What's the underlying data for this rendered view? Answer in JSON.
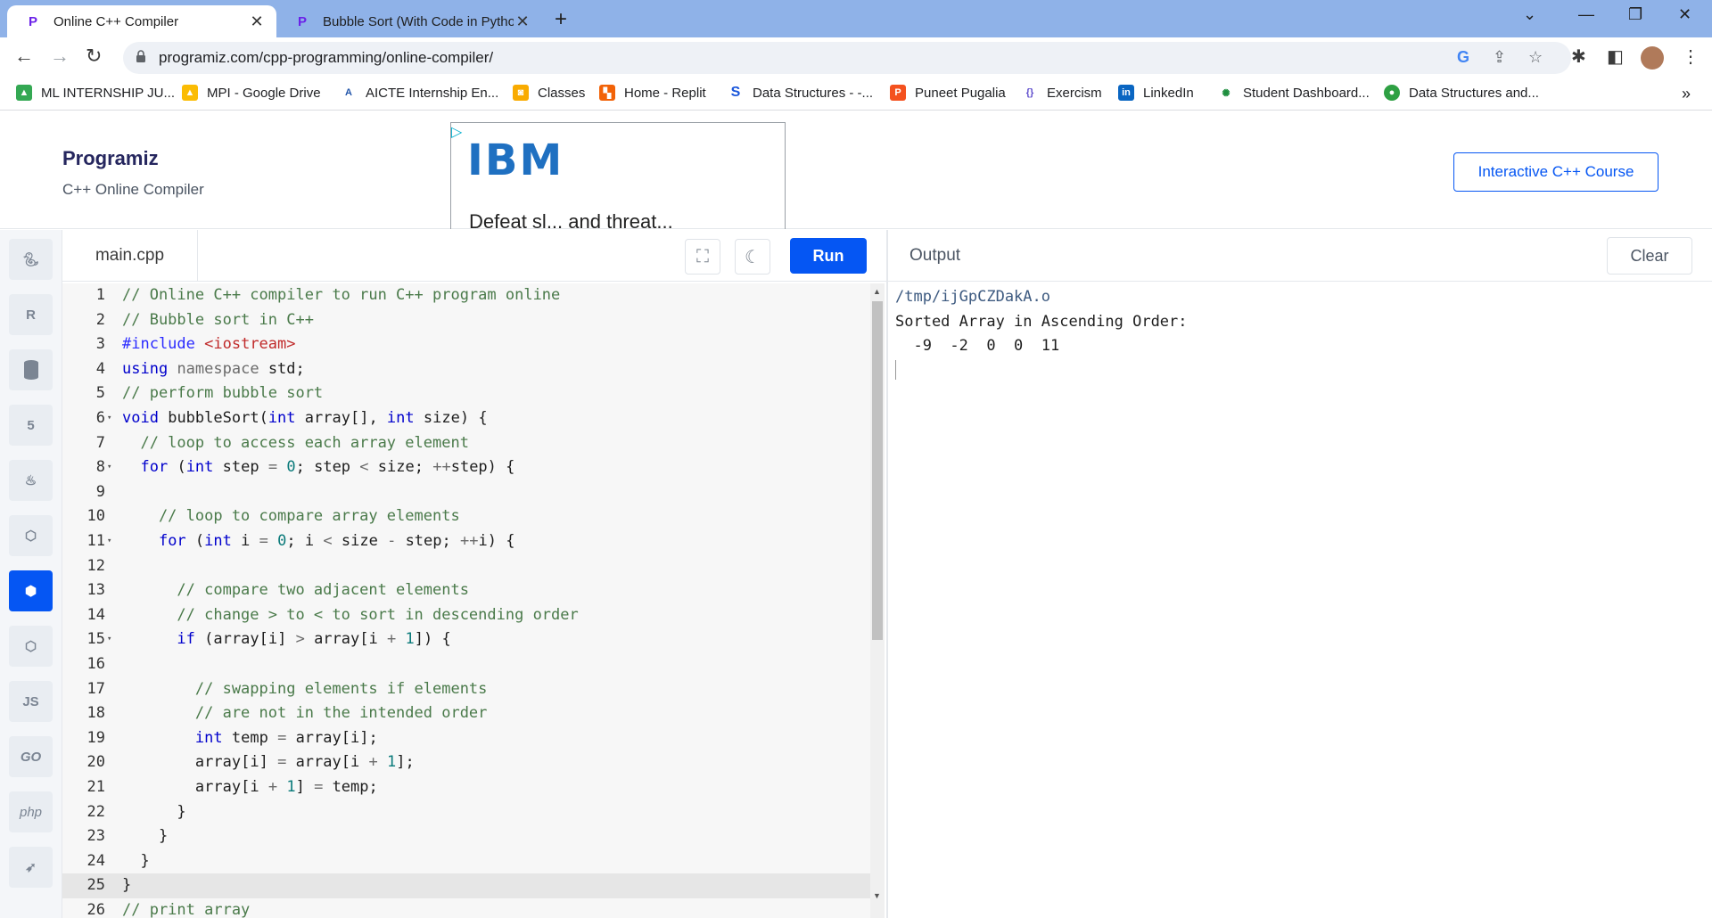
{
  "tabs": [
    {
      "title": "Online C++ Compiler",
      "icon": "programiz-favicon"
    },
    {
      "title": "Bubble Sort (With Code in Python",
      "icon": "programiz-favicon"
    }
  ],
  "address_bar": {
    "url": "programiz.com/cpp-programming/online-compiler/"
  },
  "bookmarks": [
    {
      "label": "ML INTERNSHIP JU...",
      "icon": "google-drive-icon"
    },
    {
      "label": "MPI - Google Drive",
      "icon": "google-drive-icon"
    },
    {
      "label": "AICTE Internship En...",
      "icon": "aicte-icon"
    },
    {
      "label": "Classes",
      "icon": "classroom-icon"
    },
    {
      "label": "Home - Replit",
      "icon": "replit-icon"
    },
    {
      "label": "Data Structures - -...",
      "icon": "data-structures-icon"
    },
    {
      "label": "Puneet Pugalia",
      "icon": "p-icon"
    },
    {
      "label": "Exercism",
      "icon": "exercism-icon"
    },
    {
      "label": "LinkedIn",
      "icon": "linkedin-icon"
    },
    {
      "label": "Student Dashboard...",
      "icon": "dashboard-icon"
    },
    {
      "label": "Data Structures and...",
      "icon": "ds-green-icon"
    }
  ],
  "header": {
    "logo": "Programiz",
    "subtitle": "C++ Online Compiler",
    "ad_brand": "IBM",
    "ad_text": "Defeat sl... and threat...",
    "course_button": "Interactive C++ Course"
  },
  "rail": [
    {
      "icon": "python-icon",
      "label": ""
    },
    {
      "icon": "r-icon",
      "label": ""
    },
    {
      "icon": "database-icon",
      "label": ""
    },
    {
      "icon": "html5-icon",
      "label": ""
    },
    {
      "icon": "java-icon",
      "label": ""
    },
    {
      "icon": "c-icon",
      "label": ""
    },
    {
      "icon": "cpp-icon",
      "label": ""
    },
    {
      "icon": "csharp-icon",
      "label": ""
    },
    {
      "icon": "js-icon",
      "label": "JS"
    },
    {
      "icon": "go-icon",
      "label": "GO"
    },
    {
      "icon": "php-icon",
      "label": "php"
    },
    {
      "icon": "swift-icon",
      "label": ""
    }
  ],
  "editor": {
    "filename": "main.cpp",
    "run_label": "Run",
    "lines": [
      {
        "n": "1",
        "text": "// Online C++ compiler to run C++ program online"
      },
      {
        "n": "2",
        "text": "// Bubble sort in C++"
      },
      {
        "n": "3",
        "text": "#include <iostream>"
      },
      {
        "n": "4",
        "text": "using namespace std;"
      },
      {
        "n": "5",
        "text": "// perform bubble sort"
      },
      {
        "n": "6",
        "text": "void bubbleSort(int array[], int size) {"
      },
      {
        "n": "7",
        "text": "  // loop to access each array element"
      },
      {
        "n": "8",
        "text": "  for (int step = 0; step < size; ++step) {"
      },
      {
        "n": "9",
        "text": ""
      },
      {
        "n": "10",
        "text": "    // loop to compare array elements"
      },
      {
        "n": "11",
        "text": "    for (int i = 0; i < size - step; ++i) {"
      },
      {
        "n": "12",
        "text": ""
      },
      {
        "n": "13",
        "text": "      // compare two adjacent elements"
      },
      {
        "n": "14",
        "text": "      // change > to < to sort in descending order"
      },
      {
        "n": "15",
        "text": "      if (array[i] > array[i + 1]) {"
      },
      {
        "n": "16",
        "text": ""
      },
      {
        "n": "17",
        "text": "        // swapping elements if elements"
      },
      {
        "n": "18",
        "text": "        // are not in the intended order"
      },
      {
        "n": "19",
        "text": "        int temp = array[i];"
      },
      {
        "n": "20",
        "text": "        array[i] = array[i + 1];"
      },
      {
        "n": "21",
        "text": "        array[i + 1] = temp;"
      },
      {
        "n": "22",
        "text": "      }"
      },
      {
        "n": "23",
        "text": "    }"
      },
      {
        "n": "24",
        "text": "  }"
      },
      {
        "n": "25",
        "text": "}"
      },
      {
        "n": "26",
        "text": "// print array"
      }
    ]
  },
  "output": {
    "title": "Output",
    "clear_label": "Clear",
    "lines": [
      "/tmp/ijGpCZDakA.o",
      "Sorted Array in Ascending Order:",
      "  -9  -2  0  0  11"
    ]
  }
}
